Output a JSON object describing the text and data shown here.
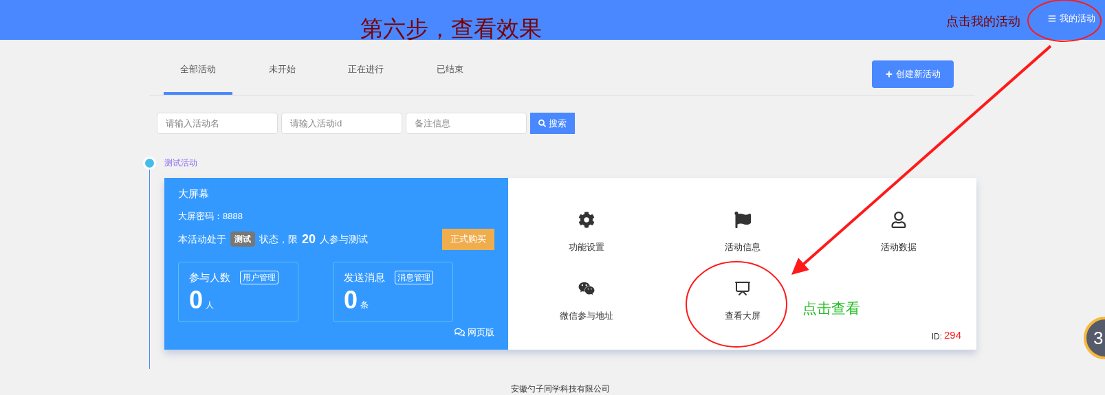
{
  "header": {
    "menu_button": "我的活动"
  },
  "tabs": [
    {
      "label": "全部活动",
      "selected": true
    },
    {
      "label": "未开始",
      "selected": false
    },
    {
      "label": "正在进行",
      "selected": false
    },
    {
      "label": "已结束",
      "selected": false
    }
  ],
  "create_button": "创建新活动",
  "search": {
    "fields": [
      {
        "placeholder": "请输入活动名"
      },
      {
        "placeholder": "请输入活动id"
      },
      {
        "placeholder": "备注信息"
      }
    ],
    "button": "搜索"
  },
  "activities": [
    {
      "group_label": "测试活动",
      "title": "大屏幕",
      "password_label": "大屏密码：",
      "password": "8888",
      "status_prefix": "本活动处于",
      "status_tag": "测试",
      "status_mid": "状态，限",
      "limit": "20",
      "status_suffix": "人参与测试",
      "buy_button": "正式购买",
      "stats": [
        {
          "label": "参与人数",
          "button": "用户管理",
          "value": "0",
          "unit": "人"
        },
        {
          "label": "发送消息",
          "button": "消息管理",
          "value": "0",
          "unit": "条"
        }
      ],
      "web_link": "网页版",
      "actions": [
        {
          "kind": "settings",
          "label": "功能设置"
        },
        {
          "kind": "flag",
          "label": "活动信息"
        },
        {
          "kind": "user",
          "label": "活动数据"
        },
        {
          "kind": "wechat",
          "label": "微信参与地址"
        },
        {
          "kind": "screen",
          "label": "查看大屏"
        }
      ],
      "id_label": "ID:",
      "id": "294"
    }
  ],
  "footer": "安徽勺子同学科技有限公司",
  "floating_badge": "3",
  "annotations": [
    {
      "kind": "title",
      "text": "第六步，查看效果",
      "color": "#7a0000"
    },
    {
      "kind": "menu_hint",
      "text": "点击我的活动",
      "color": "#7a0000"
    },
    {
      "kind": "view_hint",
      "text": "点击查看",
      "color": "#22bb22"
    }
  ]
}
